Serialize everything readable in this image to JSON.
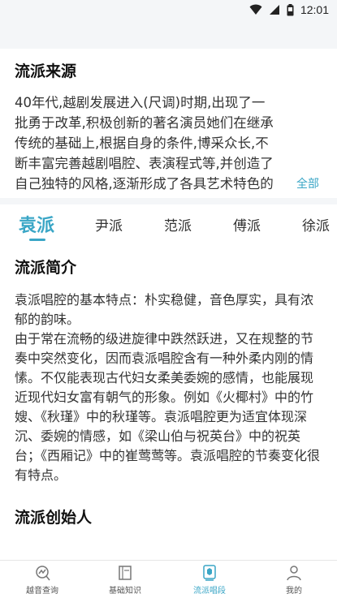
{
  "status_bar": {
    "time": "12:01"
  },
  "origin": {
    "title": "流派来源",
    "body": "40年代,越剧发展进入(尺调)时期,出现了一批勇于改革,积极创新的著名演员她们在继承传统的基础上,根据自身的条件,博采众长,不断丰富完善越剧唱腔、表演程式等,并创造了自己独特的风格,逐渐形成了各具艺术特色的越剧流派。",
    "more_label": "全部"
  },
  "tabs": [
    "袁派",
    "尹派",
    "范派",
    "傅派",
    "徐派"
  ],
  "active_tab_index": 0,
  "intro": {
    "title": "流派简介",
    "body": "袁派唱腔的基本特点：朴实稳健，音色厚实，具有浓郁的韵味。\n由于常在流畅的级进旋律中跌然跃进，又在规整的节奏中突然变化，因而袁派唱腔含有一种外柔内刚的情愫。不仅能表现古代妇女柔美委婉的感情，也能展现近现代妇女富有朝气的形象。例如《火椰村》中的竹嫂、《秋瑾》中的秋瑾等。袁派唱腔更为适宜体现深沉、委婉的情感，如《梁山伯与祝英台》中的祝英台；《西厢记》中的崔莺莺等。袁派唱腔的节奏变化很有特点。"
  },
  "founder": {
    "title": "流派创始人"
  },
  "bottom_nav": [
    {
      "label": "越音查询",
      "icon": "search-chart-icon"
    },
    {
      "label": "基础知识",
      "icon": "book-icon"
    },
    {
      "label": "流派唱段",
      "icon": "school-badge-icon"
    },
    {
      "label": "我的",
      "icon": "user-icon"
    }
  ],
  "colors": {
    "accent": "#3aa6c6",
    "background_gray": "#f4f6f8"
  }
}
